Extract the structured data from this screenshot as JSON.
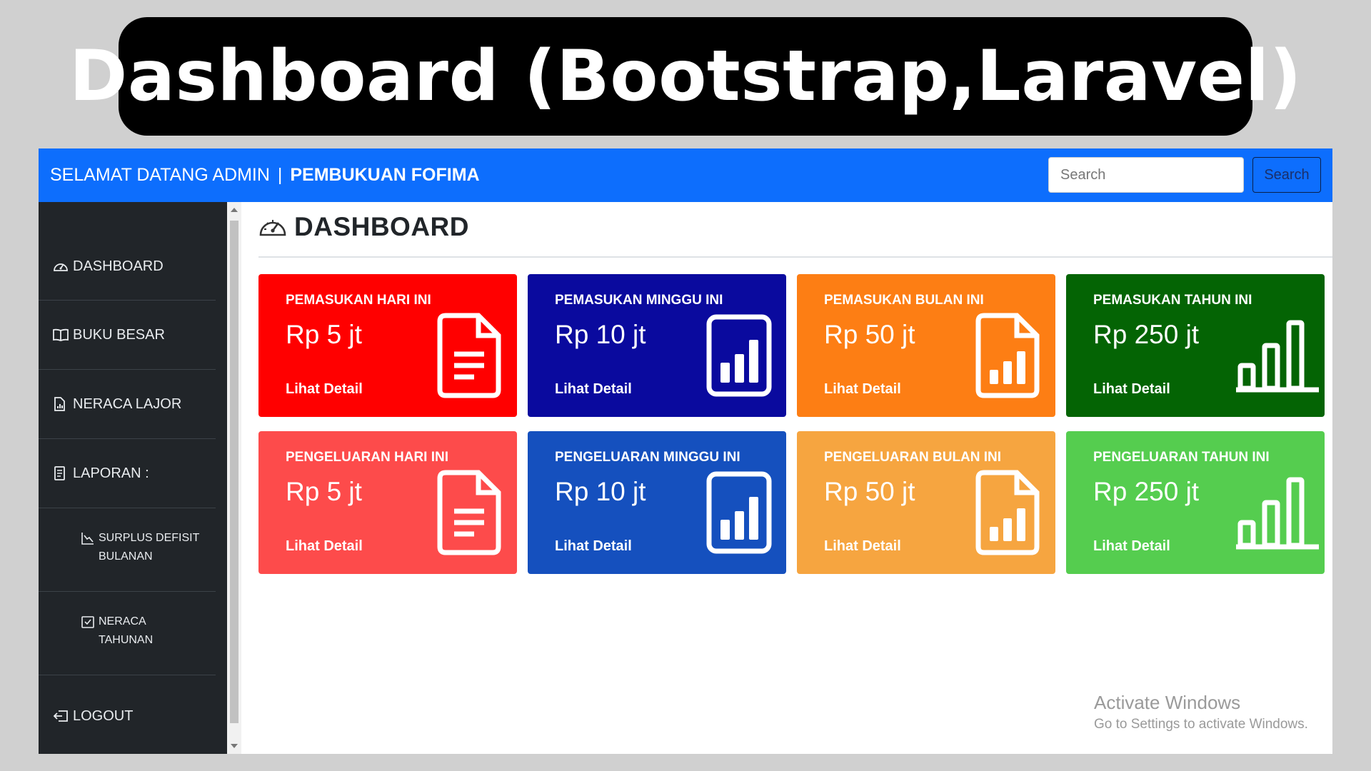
{
  "banner": {
    "title": "Dashboard (Bootstrap,Laravel)"
  },
  "navbar": {
    "welcome": "SELAMAT DATANG ADMIN",
    "separator": "|",
    "app_name": "PEMBUKUAN FOFIMA",
    "search_placeholder": "Search",
    "search_button": "Search",
    "color": "#0d6efd"
  },
  "sidebar": {
    "items": [
      {
        "label": "DASHBOARD",
        "icon": "speedometer-icon"
      },
      {
        "label": "BUKU BESAR",
        "icon": "book-icon"
      },
      {
        "label": "NERACA LAJOR",
        "icon": "file-chart-icon"
      },
      {
        "label": "LAPORAN :",
        "icon": "document-icon"
      },
      {
        "label_line1": "SURPLUS DEFISIT",
        "label_line2": "BULANAN",
        "icon": "graph-down-icon"
      },
      {
        "label_line1": "NERACA",
        "label_line2": "TAHUNAN",
        "icon": "calendar-check-icon"
      },
      {
        "label": "LOGOUT",
        "icon": "box-arrow-left-icon"
      }
    ]
  },
  "main": {
    "title": "DASHBOARD",
    "title_icon": "speedometer-icon"
  },
  "cards": [
    {
      "label": "PEMASUKAN HARI INI",
      "value": "Rp 5 jt",
      "link": "Lihat Detail",
      "color": "#ff0000",
      "icon": "file-text-icon"
    },
    {
      "label": "PEMASUKAN MINGGU INI",
      "value": "Rp 10 jt",
      "link": "Lihat Detail",
      "color": "#0a0a9e",
      "icon": "bar-chart-square-icon"
    },
    {
      "label": "PEMASUKAN BULAN INI",
      "value": "Rp 50 jt",
      "link": "Lihat Detail",
      "color": "#fd7e14",
      "icon": "file-bar-chart-icon"
    },
    {
      "label": "PEMASUKAN TAHUN INI",
      "value": "Rp 250 jt",
      "link": "Lihat Detail",
      "color": "#046404",
      "icon": "bar-chart-icon"
    },
    {
      "label": "PENGELUARAN HARI INI",
      "value": "Rp 5 jt",
      "link": "Lihat Detail",
      "color": "#fd4b4b",
      "icon": "file-text-icon"
    },
    {
      "label": "PENGELUARAN MINGGU INI",
      "value": "Rp 10 jt",
      "link": "Lihat Detail",
      "color": "#1550be",
      "icon": "bar-chart-square-icon"
    },
    {
      "label": "PENGELUARAN BULAN INI",
      "value": "Rp 50 jt",
      "link": "Lihat Detail",
      "color": "#f6a540",
      "icon": "file-bar-chart-icon"
    },
    {
      "label": "PENGELUARAN TAHUN INI",
      "value": "Rp 250 jt",
      "link": "Lihat Detail",
      "color": "#55cd4f",
      "icon": "bar-chart-icon"
    }
  ],
  "watermark": {
    "title": "Activate Windows",
    "subtitle": "Go to Settings to activate Windows."
  }
}
